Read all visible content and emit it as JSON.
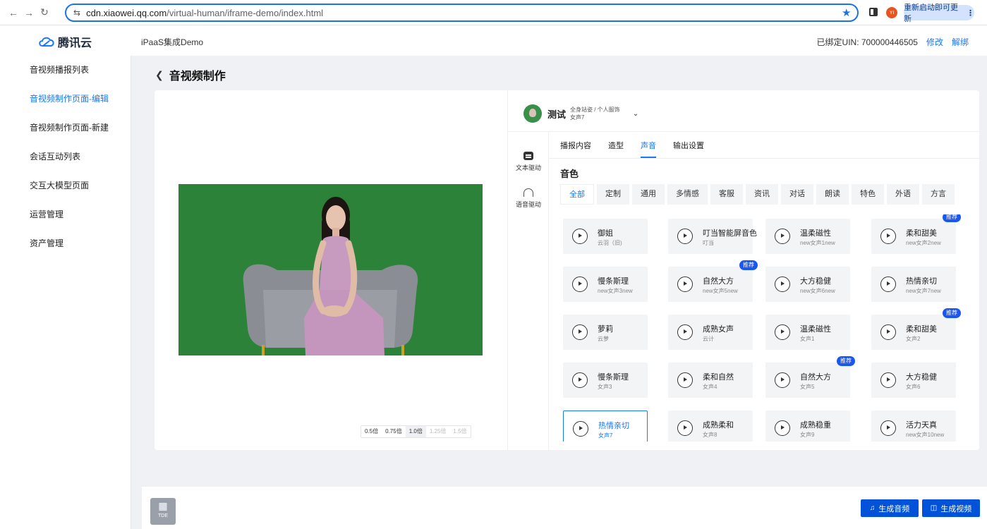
{
  "browser": {
    "url_domain": "cdn.xiaowei.qq.com",
    "url_path": "/virtual-human/iframe-demo/index.html",
    "profile_initial": "YI",
    "update_label": "重新启动即可更新"
  },
  "header": {
    "logo_text": "腾讯云",
    "app_title": "iPaaS集成Demo",
    "uin_label": "已绑定UIN: 700000446505",
    "edit_link": "修改",
    "unbind_link": "解绑"
  },
  "sidebar": {
    "items": [
      {
        "label": "音视频播报列表"
      },
      {
        "label": "音视频制作页面-编辑"
      },
      {
        "label": "音视频制作页面-新建"
      },
      {
        "label": "会话互动列表"
      },
      {
        "label": "交互大模型页面"
      },
      {
        "label": "运营管理"
      },
      {
        "label": "资产管理"
      }
    ],
    "active_index": 1
  },
  "page": {
    "title": "音视频制作"
  },
  "preview": {
    "speeds": [
      "0.5倍",
      "0.75倍",
      "1.0倍",
      "1.25倍",
      "1.5倍"
    ],
    "selected_speed": "1.0倍"
  },
  "avatar": {
    "name": "测试",
    "pose": "全身站姿 / 个人服饰",
    "voice": "女声7"
  },
  "modes": {
    "text": "文本驱动",
    "voice": "语音驱动"
  },
  "tabs": [
    "播报内容",
    "造型",
    "声音",
    "输出设置"
  ],
  "active_tab": "声音",
  "voice_section": {
    "title": "音色",
    "filters": [
      "全部",
      "定制",
      "通用",
      "多情感",
      "客服",
      "资讯",
      "对话",
      "朗读",
      "特色",
      "外语",
      "方言"
    ],
    "active_filter": "全部",
    "badge_label": "推荐",
    "cards": [
      {
        "name": "御姐",
        "sub": "云羽（旧)",
        "badge": false
      },
      {
        "name": "叮当智能屏音色",
        "sub": "叮当",
        "badge": false
      },
      {
        "name": "温柔磁性",
        "sub": "new女声1new",
        "badge": false
      },
      {
        "name": "柔和甜美",
        "sub": "new女声2new",
        "badge": true
      },
      {
        "name": "慢条斯理",
        "sub": "new女声3new",
        "badge": false
      },
      {
        "name": "自然大方",
        "sub": "new女声5new",
        "badge": true
      },
      {
        "name": "大方稳健",
        "sub": "new女声6new",
        "badge": false
      },
      {
        "name": "热情亲切",
        "sub": "new女声7new",
        "badge": false
      },
      {
        "name": "萝莉",
        "sub": "云萝",
        "badge": false
      },
      {
        "name": "成熟女声",
        "sub": "云计",
        "badge": false
      },
      {
        "name": "温柔磁性",
        "sub": "女声1",
        "badge": false
      },
      {
        "name": "柔和甜美",
        "sub": "女声2",
        "badge": true
      },
      {
        "name": "慢条斯理",
        "sub": "女声3",
        "badge": false
      },
      {
        "name": "柔和自然",
        "sub": "女声4",
        "badge": false
      },
      {
        "name": "自然大方",
        "sub": "女声5",
        "badge": true
      },
      {
        "name": "大方稳健",
        "sub": "女声6",
        "badge": false
      },
      {
        "name": "热情亲切",
        "sub": "女声7",
        "badge": false,
        "selected": true
      },
      {
        "name": "成熟柔和",
        "sub": "女声8",
        "badge": false
      },
      {
        "name": "成熟稳重",
        "sub": "女声9",
        "badge": false
      },
      {
        "name": "活力天真",
        "sub": "new女声10new",
        "badge": false
      }
    ]
  },
  "footer": {
    "logo_text": "TDE",
    "gen_audio": "生成音频",
    "gen_video": "生成视频"
  },
  "colors": {
    "accent": "#1677ff",
    "primary_button": "#0052d9",
    "green_screen": "#2f8a3d"
  }
}
